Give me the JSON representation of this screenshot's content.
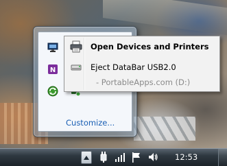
{
  "context_menu": {
    "items": [
      {
        "label": "Open Devices and Printers",
        "icon": "printer-icon",
        "bold": true,
        "enabled": true
      },
      {
        "label": "Eject DataBar USB2.0",
        "icon": "usb-drive-icon",
        "bold": false,
        "enabled": true
      },
      {
        "label": "- PortableApps.com (D:)",
        "icon": "",
        "bold": false,
        "enabled": false
      }
    ]
  },
  "tray_flyout": {
    "customize_label": "Customize...",
    "icons": [
      "network-map-icon",
      "onenote-icon",
      "sync-icon",
      "usb-safely-remove-icon"
    ]
  },
  "taskbar": {
    "clock": "12:53",
    "icons": [
      "show-hidden-icons-arrow",
      "power-plug-icon",
      "signal-bars-icon",
      "flag-icon",
      "speaker-icon"
    ]
  },
  "colors": {
    "link": "#1a5fb4",
    "menu_bg": "#f2f2f2",
    "taskbar": "#2e3840"
  }
}
